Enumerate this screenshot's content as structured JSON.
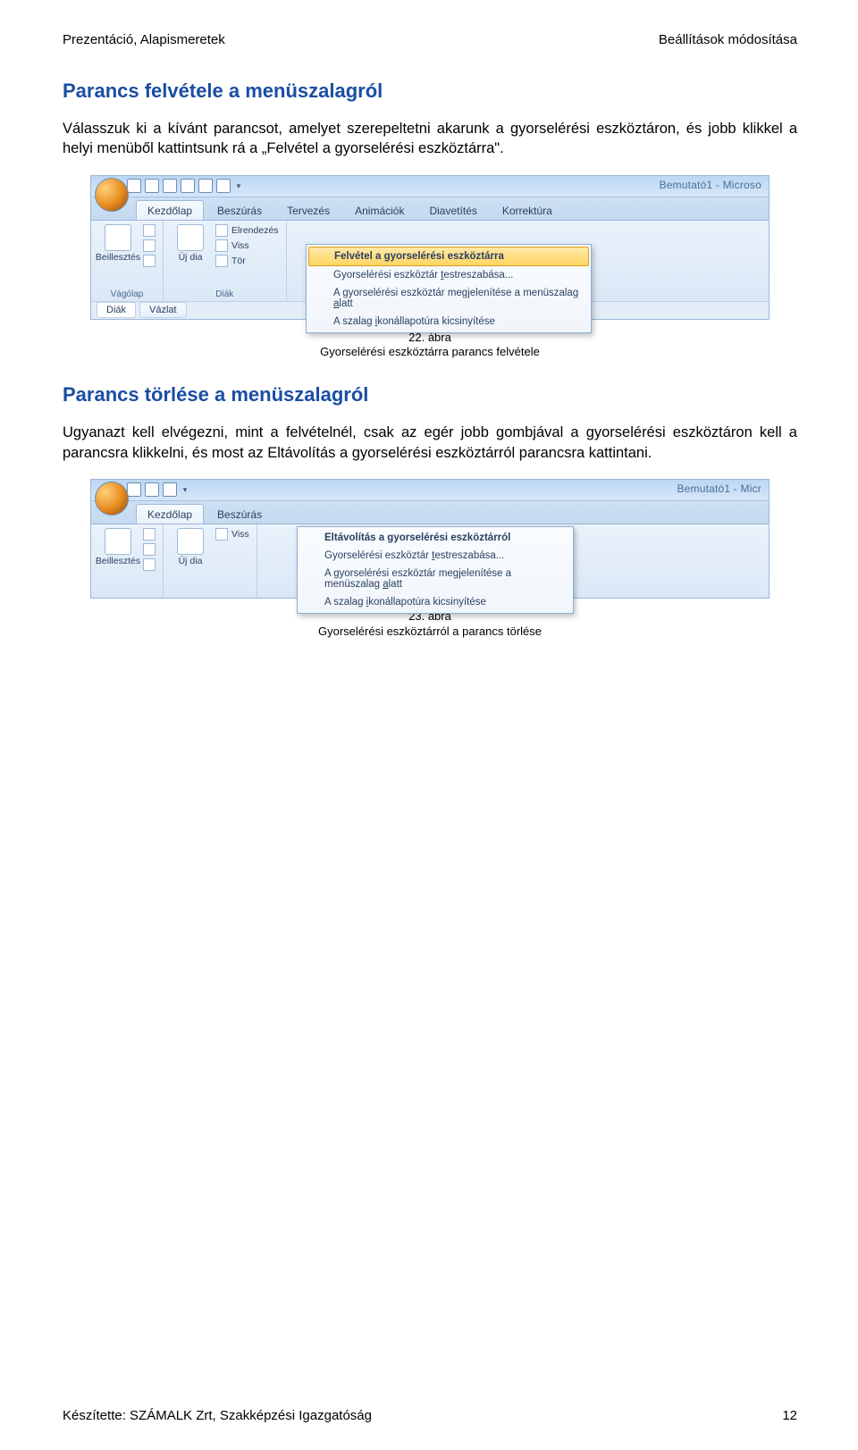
{
  "header": {
    "left": "Prezentáció, Alapismeretek",
    "right": "Beállítások módosítása"
  },
  "section1": {
    "title": "Parancs felvétele a menüszalagról",
    "paragraph": "Válasszuk ki a kívánt parancsot, amelyet szerepeltetni akarunk a gyorselérési eszköztáron, és jobb klikkel a helyi menüből kattintsunk rá a „Felvétel a gyorselérési eszköztárra\"."
  },
  "caption1": {
    "num": "22. ábra",
    "text": "Gyorselérési eszköztárra parancs felvétele"
  },
  "section2": {
    "title": "Parancs törlése a menüszalagról",
    "paragraph": "Ugyanazt kell elvégezni, mint a felvételnél, csak az egér jobb gombjával a gyorselérési eszköztáron kell a parancsra klikkelni, és most az Eltávolítás a gyorselérési eszköztárról parancsra kattintani."
  },
  "caption2": {
    "num": "23. ábra",
    "text": "Gyorselérési eszköztárról a parancs törlése"
  },
  "footer": {
    "left": "Készítette: SZÁMALK Zrt, Szakképzési Igazgatóság",
    "page": "12"
  },
  "ribbon": {
    "title1": "Bemutató1 - Microso",
    "title2": "Bemutató1 - Micr",
    "tabs": [
      "Kezdőlap",
      "Beszúrás",
      "Tervezés",
      "Animációk",
      "Diavetítés",
      "Korrektúra"
    ],
    "clip_paste": "Beillesztés",
    "clip_group": "Vágólap",
    "slide_new": "Új dia",
    "slide_layout": "Elrendezés",
    "slide_reset": "Viss",
    "slide_delete": "Tör",
    "slide_group": "Diák",
    "outline_tabs": [
      "Diák",
      "Vázlat"
    ]
  },
  "menu1": {
    "i1": "Felvétel a gyorselérési eszköztárra",
    "i2_a": "Gyorselérési eszköztár ",
    "i2_u": "t",
    "i2_b": "estreszabása...",
    "i3_a": "A gyorselérési eszköztár megjelenítése a menüszalag ",
    "i3_u": "a",
    "i3_b": "latt",
    "i4_a": "A szalag ",
    "i4_u": "i",
    "i4_b": "konállapotúra kicsinyítése"
  },
  "menu2": {
    "i1": "Eltávolítás a gyorselérési eszköztárról",
    "i2_a": "Gyorselérési eszköztár ",
    "i2_u": "t",
    "i2_b": "estreszabása...",
    "i3_a": "A gyorselérési eszköztár megjelenítése a menüszalag ",
    "i3_u": "a",
    "i3_b": "latt",
    "i4_a": "A szalag ",
    "i4_u": "i",
    "i4_b": "konállapotúra kicsinyítése"
  }
}
